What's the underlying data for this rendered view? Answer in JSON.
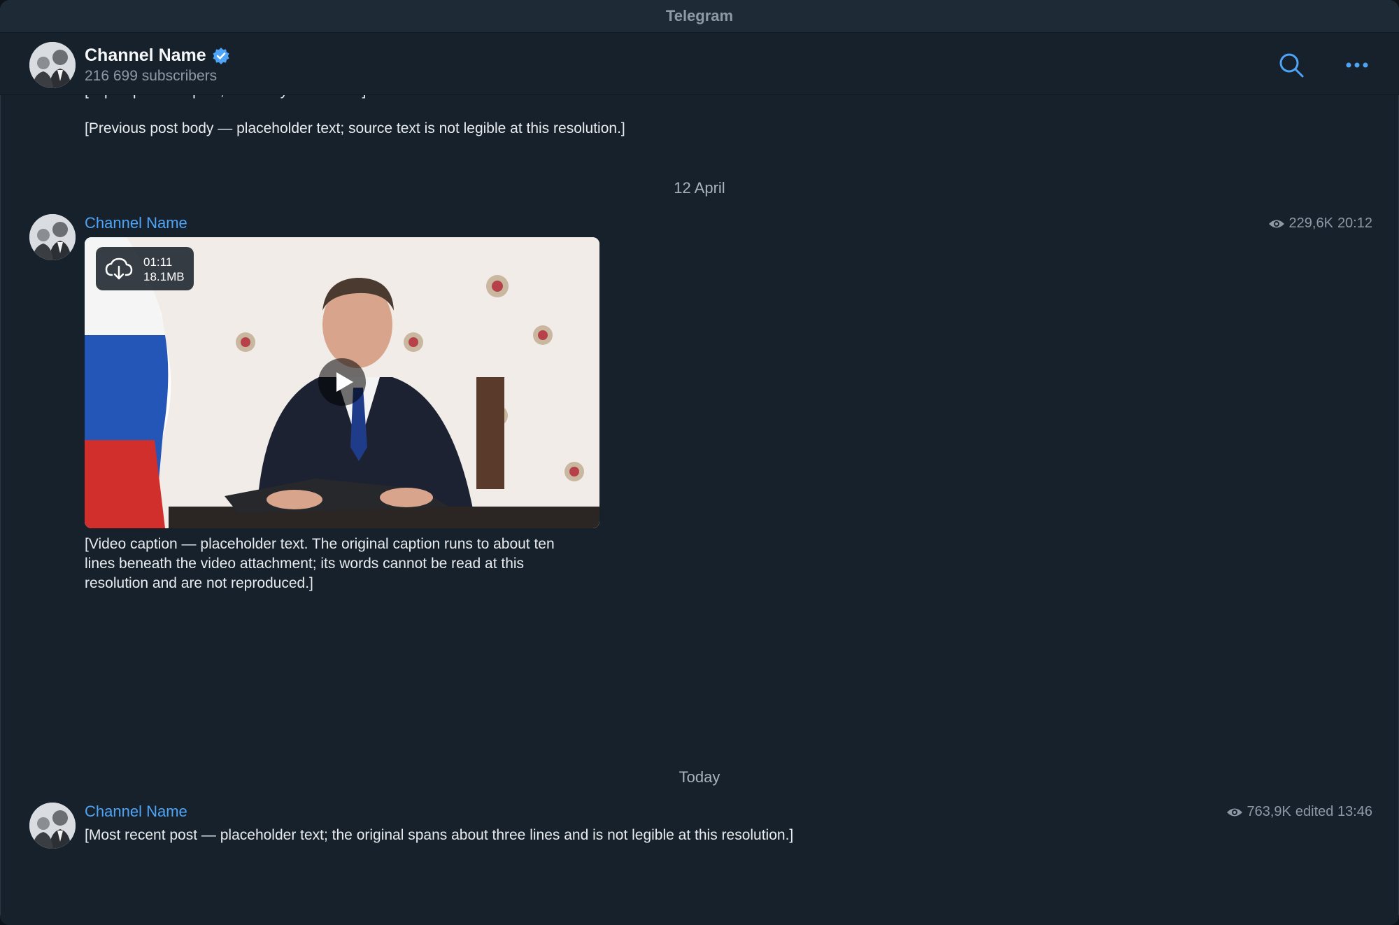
{
  "window": {
    "title": "Telegram"
  },
  "header": {
    "channel_name": "Channel Name",
    "subscribers": "216 699 subscribers",
    "verified_color": "#4ea4f6"
  },
  "icons": {
    "search": "search-icon",
    "more": "more-icon",
    "verified": "verified-badge-icon",
    "views": "eye-icon",
    "download": "cloud-download-icon",
    "play": "play-icon"
  },
  "colors": {
    "background": "#17212b",
    "author": "#4ea4f6",
    "accent": "#4ea4f6",
    "muted": "#8e99a5"
  },
  "posts": [
    {
      "clipped_line": "[Top of previous post, cut off by the header]",
      "text": "[Previous post body — placeholder text; source text is not legible at this resolution.]"
    },
    {
      "date_separator": "12 April",
      "author": "Channel Name",
      "views": "229,6K",
      "time": "20:12",
      "video": {
        "duration": "01:11",
        "size": "18.1MB"
      },
      "text": "[Video caption — placeholder text. The original caption runs to about ten lines beneath the video attachment; its words cannot be read at this resolution and are not reproduced.]"
    },
    {
      "date_separator": "Today",
      "author": "Channel Name",
      "views": "763,9K",
      "edited_time": "edited 13:46",
      "text": "[Most recent post — placeholder text; the original spans about three lines and is not legible at this resolution.]"
    }
  ]
}
